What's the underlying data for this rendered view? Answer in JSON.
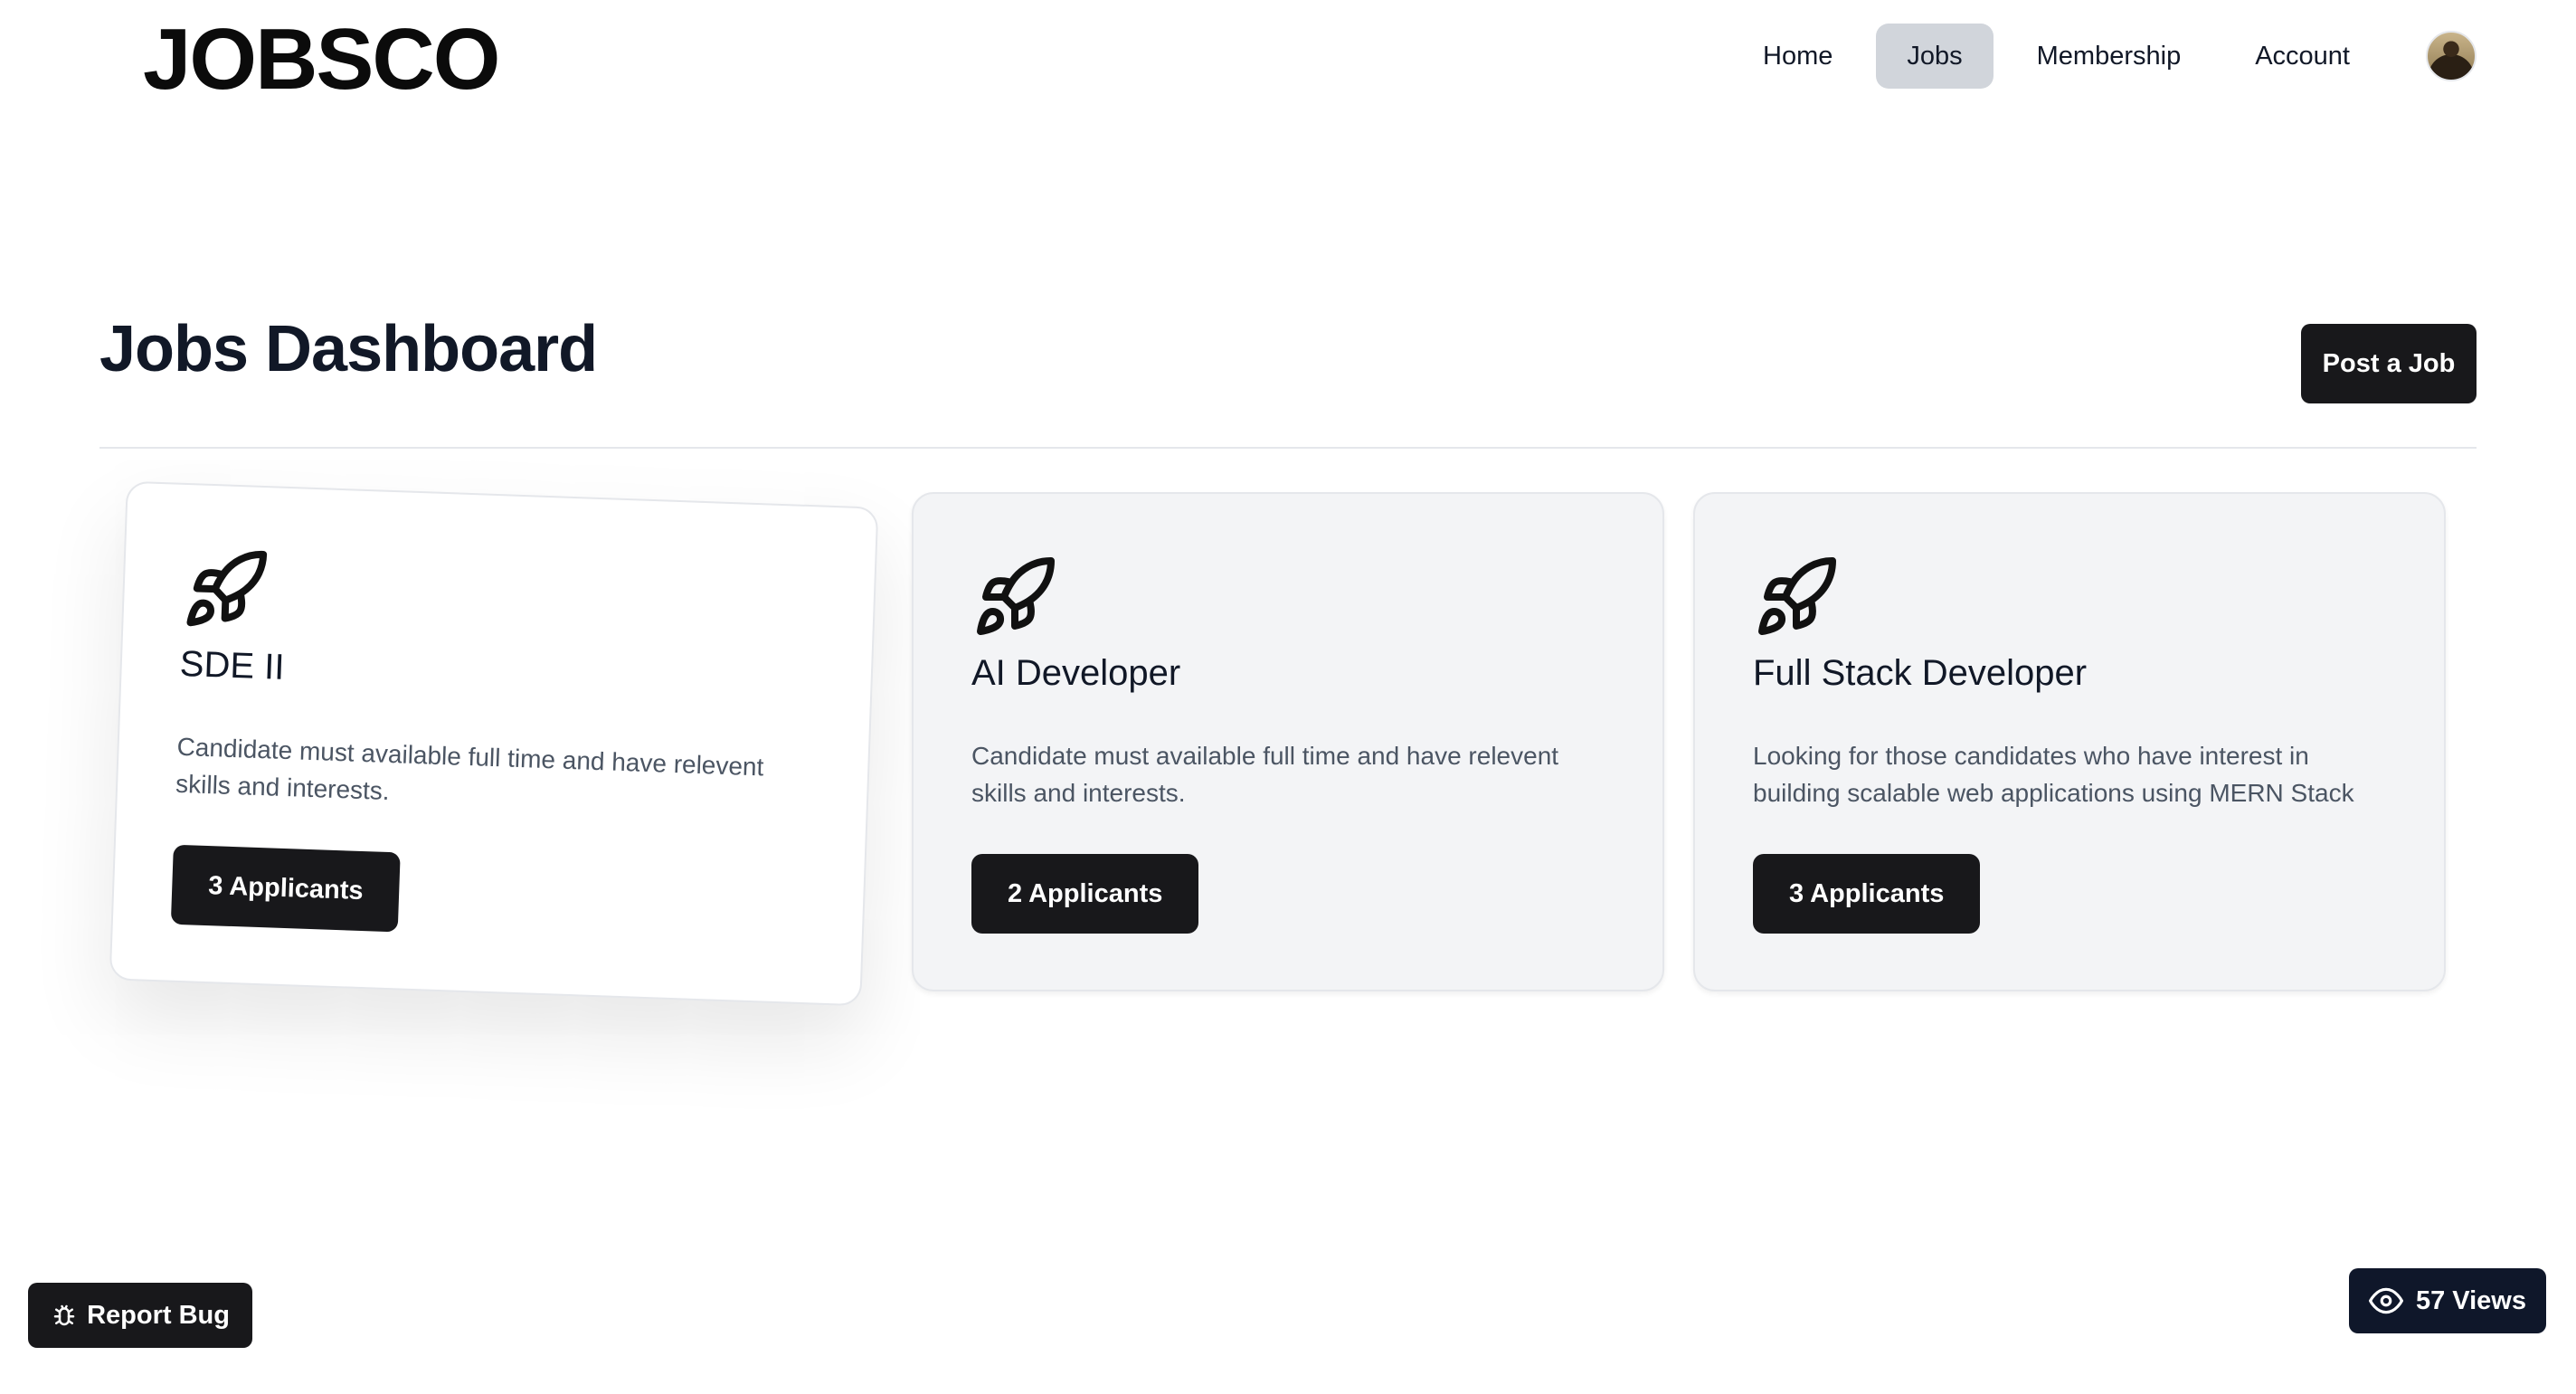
{
  "header": {
    "logo": "JOBSCO",
    "nav": [
      {
        "label": "Home",
        "active": false
      },
      {
        "label": "Jobs",
        "active": true
      },
      {
        "label": "Membership",
        "active": false
      },
      {
        "label": "Account",
        "active": false
      }
    ]
  },
  "main": {
    "title": "Jobs Dashboard",
    "post_job_label": "Post a Job"
  },
  "jobs": [
    {
      "title": "SDE II",
      "description": "Candidate must available full time and have relevent skills and interests.",
      "applicants_label": "3 Applicants",
      "icon": "rocket-icon"
    },
    {
      "title": "AI Developer",
      "description": "Candidate must available full time and have relevent skills and interests.",
      "applicants_label": "2 Applicants",
      "icon": "rocket-icon"
    },
    {
      "title": "Full Stack Developer",
      "description": "Looking for those candidates who have interest in building scalable web applications using MERN Stack",
      "applicants_label": "3 Applicants",
      "icon": "rocket-icon"
    }
  ],
  "footer": {
    "report_bug_label": "Report Bug",
    "views_label": "57 Views"
  },
  "colors": {
    "primary_button": "#18181b",
    "active_nav": "#d1d5db",
    "card_bg": "#f3f4f6"
  }
}
